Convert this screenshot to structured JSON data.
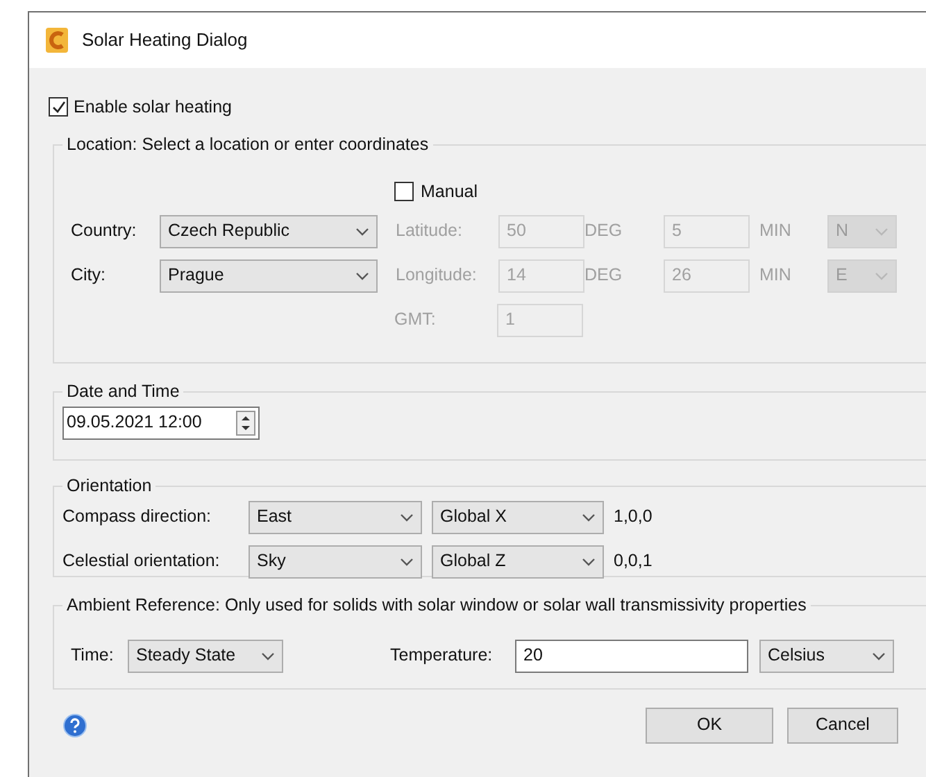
{
  "window": {
    "title": "Solar Heating Dialog"
  },
  "enable_solar_heating": {
    "label": "Enable solar heating",
    "checked": true
  },
  "location": {
    "legend": "Location: Select a location or enter coordinates",
    "manual": {
      "label": "Manual",
      "checked": false
    },
    "country": {
      "label": "Country:",
      "value": "Czech Republic"
    },
    "city": {
      "label": "City:",
      "value": "Prague"
    },
    "latitude": {
      "label": "Latitude:",
      "deg": "50",
      "deg_unit": "DEG",
      "min": "5",
      "min_unit": "MIN",
      "hemisphere": "N",
      "disabled": true
    },
    "longitude": {
      "label": "Longitude:",
      "deg": "14",
      "deg_unit": "DEG",
      "min": "26",
      "min_unit": "MIN",
      "hemisphere": "E",
      "disabled": true
    },
    "gmt": {
      "label": "GMT:",
      "value": "1",
      "disabled": true
    }
  },
  "date_and_time": {
    "legend": "Date and Time",
    "value": "09.05.2021 12:00"
  },
  "orientation": {
    "legend": "Orientation",
    "rows": [
      {
        "label": "Compass direction:",
        "direction": "East",
        "axis": "Global X",
        "vector": "1,0,0"
      },
      {
        "label": "Celestial orientation:",
        "direction": "Sky",
        "axis": "Global Z",
        "vector": "0,0,1"
      }
    ]
  },
  "ambient_reference": {
    "legend": "Ambient Reference: Only used for solids with solar window or solar wall transmissivity properties",
    "time": {
      "label": "Time:",
      "value": "Steady State"
    },
    "temperature": {
      "label": "Temperature:",
      "value": "20",
      "unit": "Celsius"
    }
  },
  "buttons": [
    "OK",
    "Cancel"
  ]
}
